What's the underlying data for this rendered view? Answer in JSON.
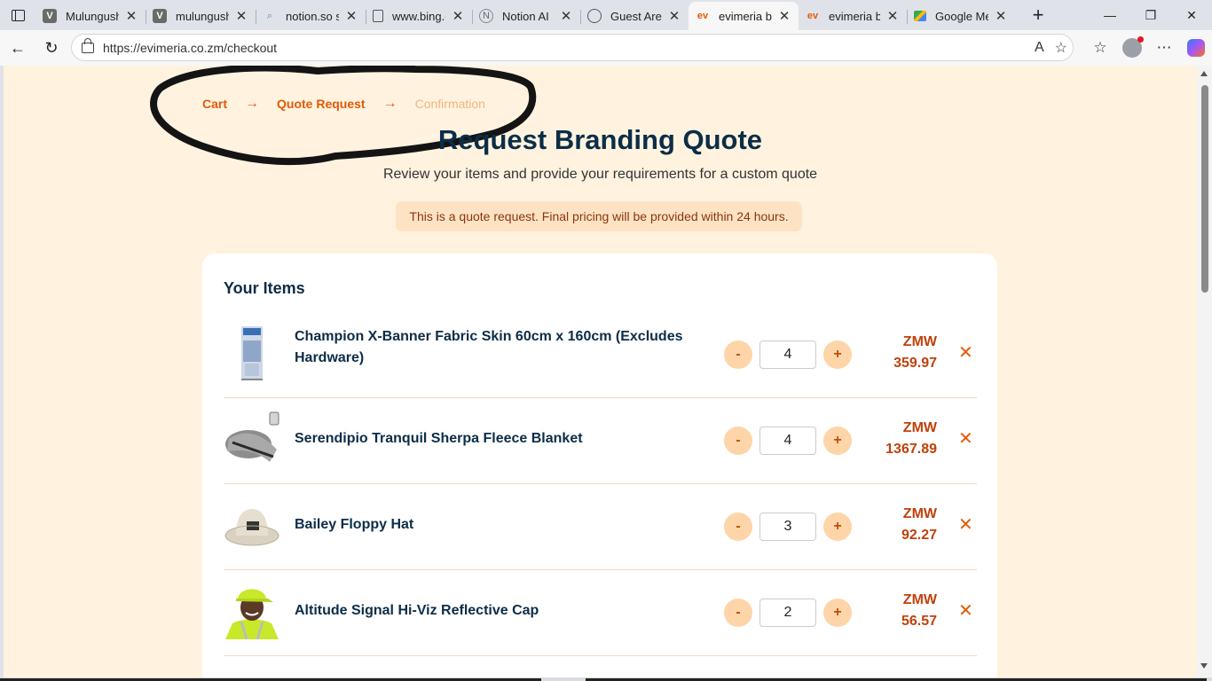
{
  "browser": {
    "tabs": [
      {
        "title": "Mulungushi",
        "icon": "v-logo-icon"
      },
      {
        "title": "mulungushi",
        "icon": "v-logo-icon"
      },
      {
        "title": "notion.so site",
        "icon": "search-icon"
      },
      {
        "title": "www.bing.com",
        "icon": "document-icon"
      },
      {
        "title": "Notion AI",
        "icon": "notion-icon"
      },
      {
        "title": "Guest Area",
        "icon": "globe-icon"
      },
      {
        "title": "evimeria br",
        "icon": "evimeria-icon",
        "active": true
      },
      {
        "title": "evimeria br",
        "icon": "evimeria-icon"
      },
      {
        "title": "Google Me",
        "icon": "google-meet-icon"
      }
    ],
    "url": "https://evimeria.co.zm/checkout"
  },
  "breadcrumb": {
    "step1": "Cart",
    "step2": "Quote Request",
    "step3": "Confirmation",
    "separator": "→"
  },
  "page": {
    "title": "Request Branding Quote",
    "subtitle": "Review your items and provide your requirements for a custom quote",
    "notice": "This is a quote request. Final pricing will be provided within 24 hours."
  },
  "items_section": {
    "heading": "Your Items",
    "minus_label": "-",
    "plus_label": "+",
    "remove_label": "✕",
    "items": [
      {
        "name": "Champion X-Banner Fabric Skin 60cm x 160cm (Excludes Hardware)",
        "qty": "4",
        "currency": "ZMW",
        "amount": "359.97"
      },
      {
        "name": "Serendipio Tranquil Sherpa Fleece Blanket",
        "qty": "4",
        "currency": "ZMW",
        "amount": "1367.89"
      },
      {
        "name": "Bailey Floppy Hat",
        "qty": "3",
        "currency": "ZMW",
        "amount": "92.27"
      },
      {
        "name": "Altitude Signal Hi-Viz Reflective Cap",
        "qty": "2",
        "currency": "ZMW",
        "amount": "56.57"
      }
    ]
  },
  "colors": {
    "accent": "#e35a06",
    "title": "#0c2d48",
    "background": "#fff3e0",
    "price": "#c0410b"
  }
}
